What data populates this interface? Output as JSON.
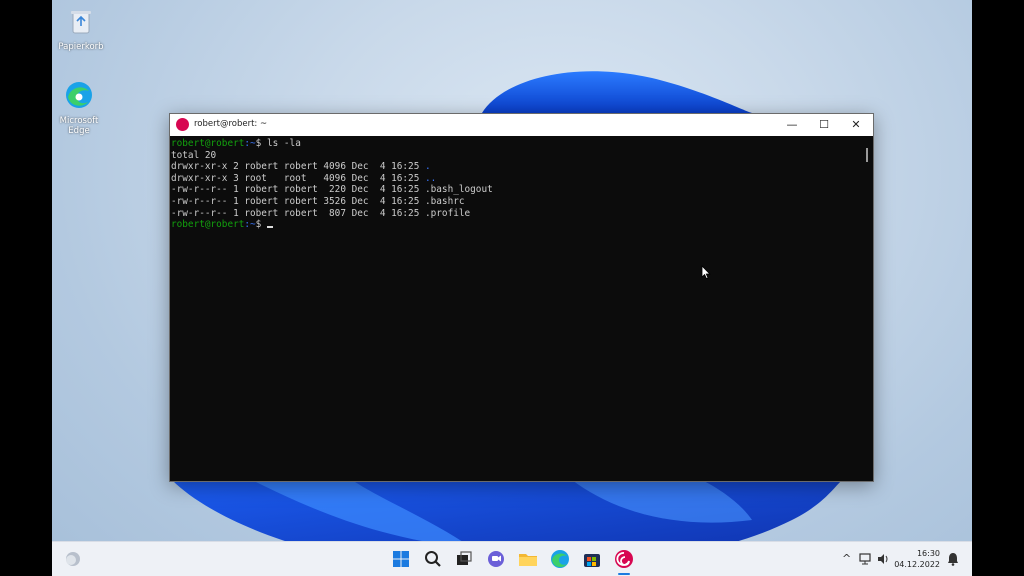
{
  "desktop": {
    "icons": [
      {
        "label": "Papierkorb",
        "icon": "recycle-bin-icon"
      },
      {
        "label": "Microsoft Edge",
        "icon": "edge-icon"
      }
    ]
  },
  "window": {
    "title": "robert@robert: ~",
    "icon": "debian-icon",
    "controls": {
      "minimize": "—",
      "maximize": "☐",
      "close": "✕"
    }
  },
  "terminal": {
    "prompt_user": "robert@robert",
    "prompt_path": ":~",
    "prompt_symbol": "$ ",
    "command": "ls -la",
    "total": "total 20",
    "listing": [
      {
        "meta": "drwxr-xr-x 2 robert robert 4096 Dec  4 16:25 ",
        "name": ".",
        "dir": true
      },
      {
        "meta": "drwxr-xr-x 3 root   root   4096 Dec  4 16:25 ",
        "name": "..",
        "dir": true
      },
      {
        "meta": "-rw-r--r-- 1 robert robert  220 Dec  4 16:25 ",
        "name": ".bash_logout",
        "dir": false
      },
      {
        "meta": "-rw-r--r-- 1 robert robert 3526 Dec  4 16:25 ",
        "name": ".bashrc",
        "dir": false
      },
      {
        "meta": "-rw-r--r-- 1 robert robert  807 Dec  4 16:25 ",
        "name": ".profile",
        "dir": false
      }
    ]
  },
  "taskbar": {
    "apps": [
      "weather-icon",
      "start-icon",
      "search-icon",
      "task-view-icon",
      "chat-icon",
      "file-explorer-icon",
      "edge-icon",
      "store-icon",
      "debian-icon"
    ],
    "time": "16:30",
    "date": "04.12.2022"
  },
  "colors": {
    "prompt_green": "#13a10e",
    "dir_blue": "#3b78ff",
    "debian_red": "#d70751"
  }
}
